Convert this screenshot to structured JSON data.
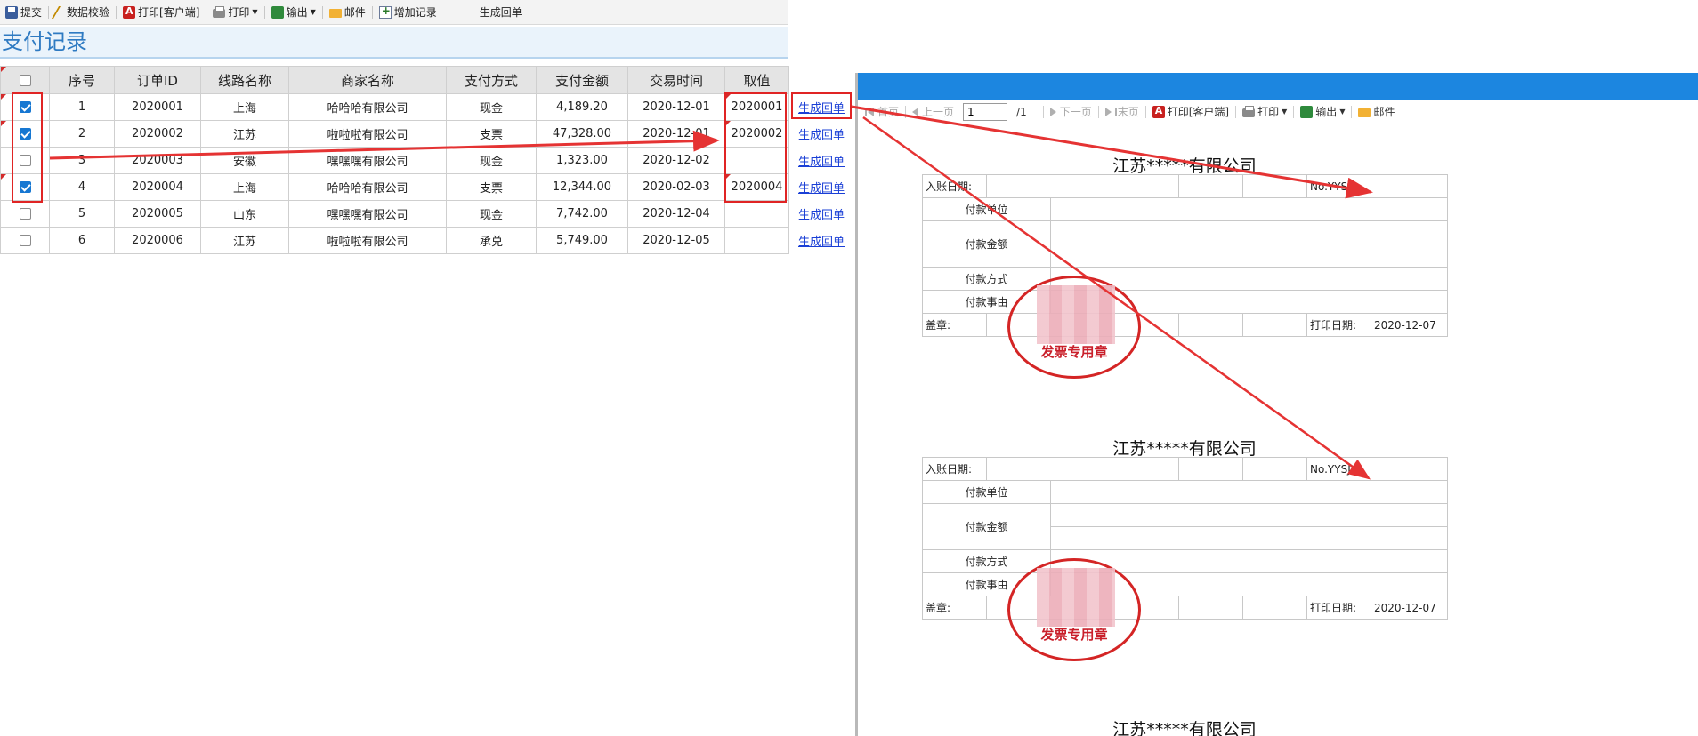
{
  "toolbar": {
    "items": [
      {
        "label": "提交",
        "icon": "save-icon"
      },
      {
        "label": "数据校验",
        "icon": "validate-icon"
      },
      {
        "label": "打印[客户端]",
        "icon": "pdf-print-icon"
      },
      {
        "label": "打印",
        "icon": "print-icon"
      },
      {
        "label": "输出",
        "icon": "export-icon"
      },
      {
        "label": "邮件",
        "icon": "mail-icon"
      },
      {
        "label": "增加记录",
        "icon": "add-record-icon"
      },
      {
        "label": "生成回单"
      }
    ]
  },
  "page_title": "支付记录",
  "table": {
    "headers": [
      "序号",
      "订单ID",
      "线路名称",
      "商家名称",
      "支付方式",
      "支付金额",
      "交易时间",
      "取值"
    ],
    "rows": [
      {
        "checked": true,
        "seq": "1",
        "order_id": "2020001",
        "route": "上海",
        "merchant": "哈哈哈有限公司",
        "pay_method": "现金",
        "amount": "4,189.20",
        "time": "2020-12-01",
        "value": "2020001",
        "action": "生成回单"
      },
      {
        "checked": true,
        "seq": "2",
        "order_id": "2020002",
        "route": "江苏",
        "merchant": "啦啦啦有限公司",
        "pay_method": "支票",
        "amount": "47,328.00",
        "time": "2020-12-01",
        "value": "2020002",
        "action": "生成回单"
      },
      {
        "checked": false,
        "seq": "3",
        "order_id": "2020003",
        "route": "安徽",
        "merchant": "嘿嘿嘿有限公司",
        "pay_method": "现金",
        "amount": "1,323.00",
        "time": "2020-12-02",
        "value": "",
        "action": "生成回单"
      },
      {
        "checked": true,
        "seq": "4",
        "order_id": "2020004",
        "route": "上海",
        "merchant": "哈哈哈有限公司",
        "pay_method": "支票",
        "amount": "12,344.00",
        "time": "2020-02-03",
        "value": "2020004",
        "action": "生成回单"
      },
      {
        "checked": false,
        "seq": "5",
        "order_id": "2020005",
        "route": "山东",
        "merchant": "嘿嘿嘿有限公司",
        "pay_method": "现金",
        "amount": "7,742.00",
        "time": "2020-12-04",
        "value": "",
        "action": "生成回单"
      },
      {
        "checked": false,
        "seq": "6",
        "order_id": "2020006",
        "route": "江苏",
        "merchant": "啦啦啦有限公司",
        "pay_method": "承兑",
        "amount": "5,749.00",
        "time": "2020-12-05",
        "value": "",
        "action": "生成回单"
      }
    ]
  },
  "preview": {
    "toolbar": {
      "first": "首页",
      "prev": "上一页",
      "page_value": "1",
      "page_total": "/1",
      "next": "下一页",
      "last": "末页",
      "print_client": "打印[客户端]",
      "print": "打印",
      "export": "输出",
      "mail": "邮件"
    },
    "receipt": {
      "title": "江苏*****有限公司",
      "entry_date_label": "入账日期:",
      "no_label": "No.YYSJ",
      "payer_label": "付款单位",
      "amount_label": "付款金额",
      "method_label": "付款方式",
      "reason_label": "付款事由",
      "seal_label": "盖章:",
      "print_date_label": "打印日期:",
      "print_date": "2020-12-07",
      "stamp_text": "发票专用章"
    }
  },
  "colors": {
    "accent": "#1c86e0",
    "title_blue": "#2e7ac2",
    "highlight_red": "#e02424",
    "link_blue": "#1a3fd6",
    "checkbox_blue": "#1677d2"
  }
}
